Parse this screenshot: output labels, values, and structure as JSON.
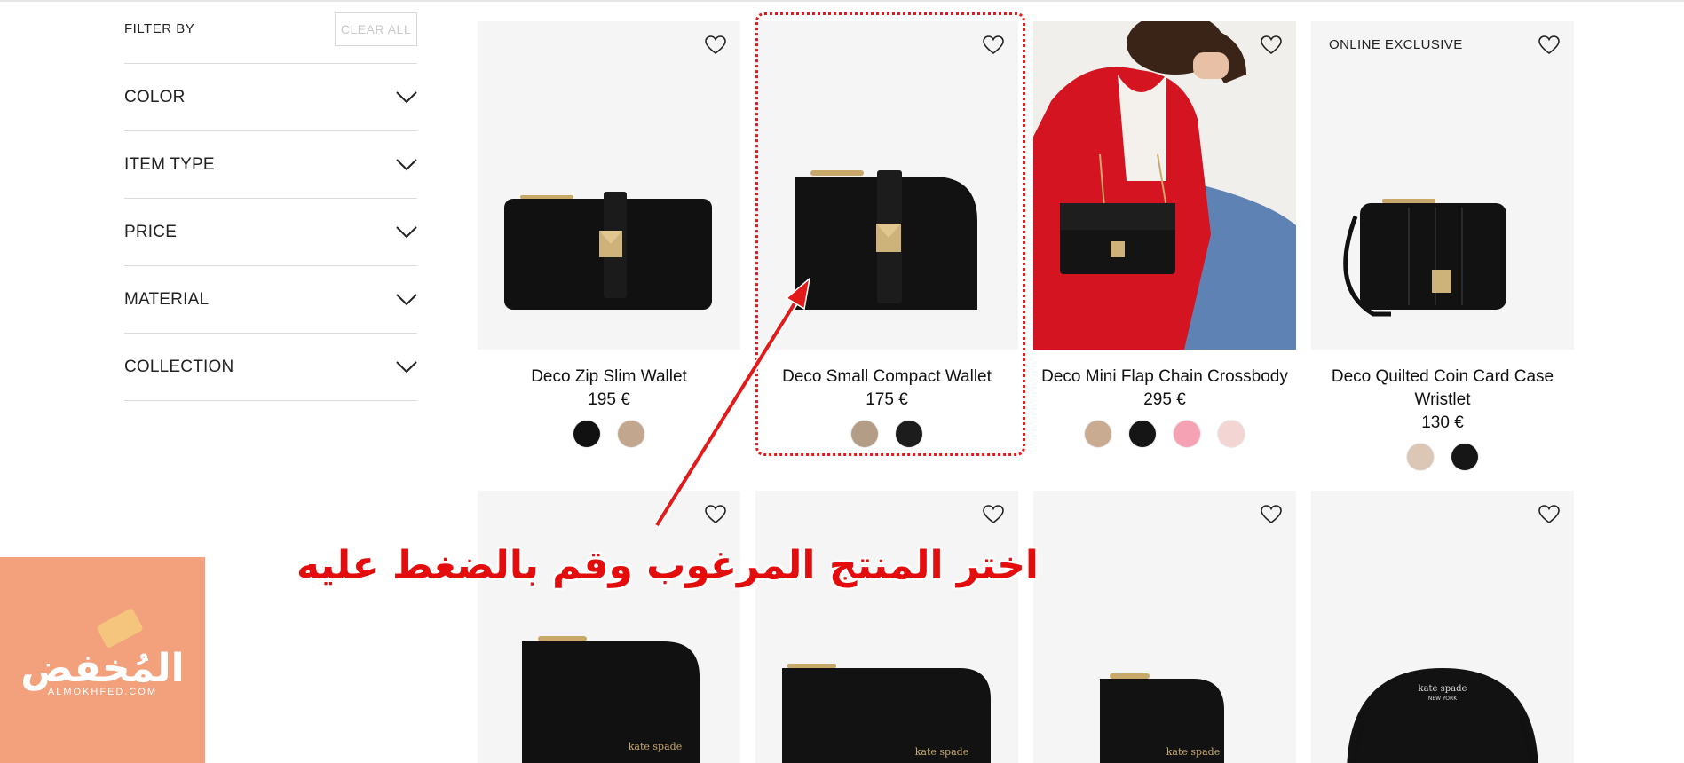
{
  "sidebar": {
    "title": "FILTER BY",
    "clear_label": "CLEAR ALL",
    "facets": [
      "COLOR",
      "ITEM TYPE",
      "PRICE",
      "MATERIAL",
      "COLLECTION"
    ]
  },
  "products": [
    {
      "name": "Deco Zip Slim Wallet",
      "price": "195 €",
      "badge": "",
      "swatches": [
        "#111111",
        "#c2a68e"
      ]
    },
    {
      "name": "Deco Small Compact Wallet",
      "price": "175 €",
      "badge": "",
      "swatches": [
        "#b49d86",
        "#1c1c1c"
      ]
    },
    {
      "name": "Deco Mini Flap Chain Crossbody",
      "price": "295 €",
      "badge": "",
      "swatches": [
        "#c9ab92",
        "#151515",
        "#f5a3b4",
        "#f3d5d4"
      ]
    },
    {
      "name": "Deco Quilted Coin Card Case Wristlet",
      "price": "130 €",
      "badge": "ONLINE EXCLUSIVE",
      "swatches": [
        "#dcc6b6",
        "#161616"
      ]
    }
  ],
  "annotation": {
    "text": "اختر المنتج المرغوب وقم بالضغط عليه",
    "color": "#e30d0d"
  },
  "watermark": {
    "brand_ar": "المُخفض",
    "brand_latin": "ALMOKHFED.COM"
  },
  "icons": {
    "heart": "heart-icon",
    "chevron": "chevron-down-icon"
  }
}
